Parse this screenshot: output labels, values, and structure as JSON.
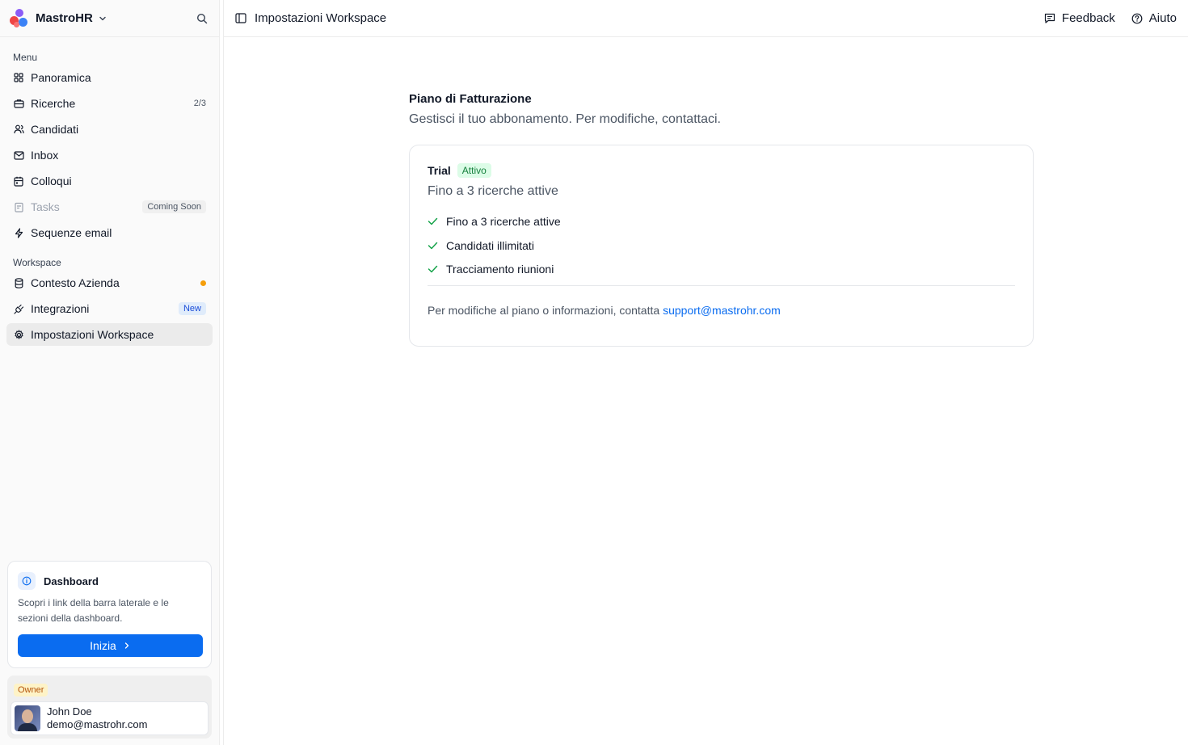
{
  "app": {
    "name": "MastroHR"
  },
  "sidebar": {
    "menu_label": "Menu",
    "workspace_label": "Workspace",
    "menu_items": [
      {
        "label": "Panoramica",
        "icon": "grid-icon"
      },
      {
        "label": "Ricerche",
        "icon": "briefcase-icon",
        "count": "2/3"
      },
      {
        "label": "Candidati",
        "icon": "users-icon"
      },
      {
        "label": "Inbox",
        "icon": "mail-icon"
      },
      {
        "label": "Colloqui",
        "icon": "calendar-icon"
      },
      {
        "label": "Tasks",
        "icon": "clipboard-icon",
        "badge": "Coming Soon"
      },
      {
        "label": "Sequenze email",
        "icon": "lightning-icon"
      }
    ],
    "workspace_items": [
      {
        "label": "Contesto Azienda",
        "icon": "database-icon",
        "dot_color": "#f59e0b"
      },
      {
        "label": "Integrazioni",
        "icon": "plug-icon",
        "badge": "New"
      },
      {
        "label": "Impostazioni Workspace",
        "icon": "gear-icon"
      }
    ],
    "tip": {
      "title": "Dashboard",
      "body": "Scopri i link della barra laterale e le sezioni della dashboard.",
      "button": "Inizia"
    },
    "user": {
      "role": "Owner",
      "name": "John Doe",
      "email": "demo@mastrohr.com"
    }
  },
  "topbar": {
    "title": "Impostazioni Workspace",
    "feedback": "Feedback",
    "help": "Aiuto"
  },
  "billing": {
    "title": "Piano di Fatturazione",
    "description": "Gestisci il tuo abbonamento. Per modifiche, contattaci.",
    "plan_name": "Trial",
    "plan_status": "Attivo",
    "plan_summary": "Fino a 3 ricerche attive",
    "features": [
      "Fino a 3 ricerche attive",
      "Candidati illimitati",
      "Tracciamento riunioni"
    ],
    "contact_text": "Per modifiche al piano o informazioni, contatta",
    "contact_email": "support@mastrohr.com"
  },
  "colors": {
    "accent": "#0a6cf0",
    "active_badge": "#15803d",
    "new_badge": "#1d4ed8",
    "owner_badge": "#b45309",
    "status_dot": "#f59e0b"
  }
}
